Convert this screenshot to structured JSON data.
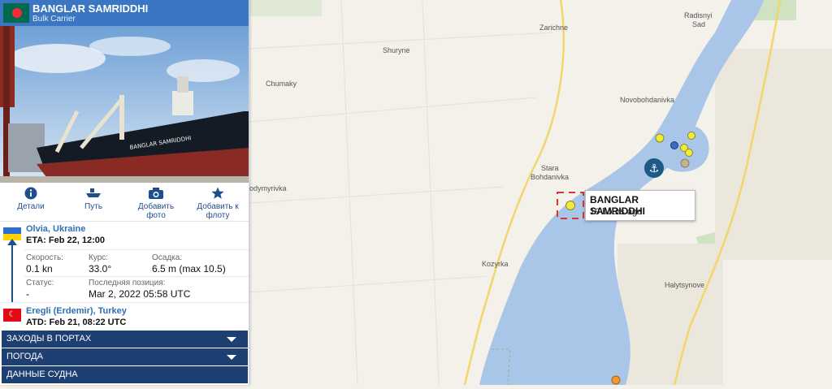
{
  "ship": {
    "name": "BANGLAR SAMRIDDHI",
    "type": "Bulk Carrier",
    "hull_text": "BANGLAR SAMRIDDHI"
  },
  "actions": [
    {
      "label": "Детали",
      "icon": "info-icon"
    },
    {
      "label": "Путь",
      "icon": "ship-icon"
    },
    {
      "label_line1": "Добавить",
      "label_line2": "фото",
      "icon": "camera-icon"
    },
    {
      "label_line1": "Добавить к",
      "label_line2": "флоту",
      "icon": "star-icon"
    }
  ],
  "destination": {
    "port": "Olvia, Ukraine",
    "eta": "ETA: Feb 22, 12:00"
  },
  "origin": {
    "port": "Eregli (Erdemir), Turkey",
    "atd": "ATD: Feb 21, 08:22 UTC"
  },
  "stats": {
    "speed_label": "Скорость:",
    "speed_value": "0.1 kn",
    "course_label": "Курс:",
    "course_value": "33.0°",
    "draft_label": "Осадка:",
    "draft_value": "6.5 m (max 10.5)",
    "status_label": "Статус:",
    "status_value": "-",
    "position_label": "Последняя позиция:",
    "position_value": "Mar 2, 2022 05:58 UTC"
  },
  "accordion": [
    "ЗАХОДЫ В ПОРТАХ",
    "ПОГОДА",
    "ДАННЫЕ СУДНА"
  ],
  "tooltip": {
    "name": "BANGLAR SAMRIDDHI",
    "age": "19 hours ago"
  },
  "map_labels": {
    "zarichne": "Zarichne",
    "shuryne": "Shuryne",
    "chumaky": "Chumaky",
    "radisnyi": "Radisnyi",
    "sad": "Sad",
    "novobohdanivka": "Novobohdanivka",
    "stara": "Stara",
    "bohdanivka": "Bohdanivka",
    "dymyrivka": "odymyrivka",
    "kozyrka": "Kozyrka",
    "halytsynove": "Halytsynove"
  },
  "colors": {
    "header": "#3a76c2",
    "accordion": "#1d3f72",
    "link": "#2f6fb7",
    "water": "#a9c6e8",
    "land": "#f3f1ea"
  }
}
